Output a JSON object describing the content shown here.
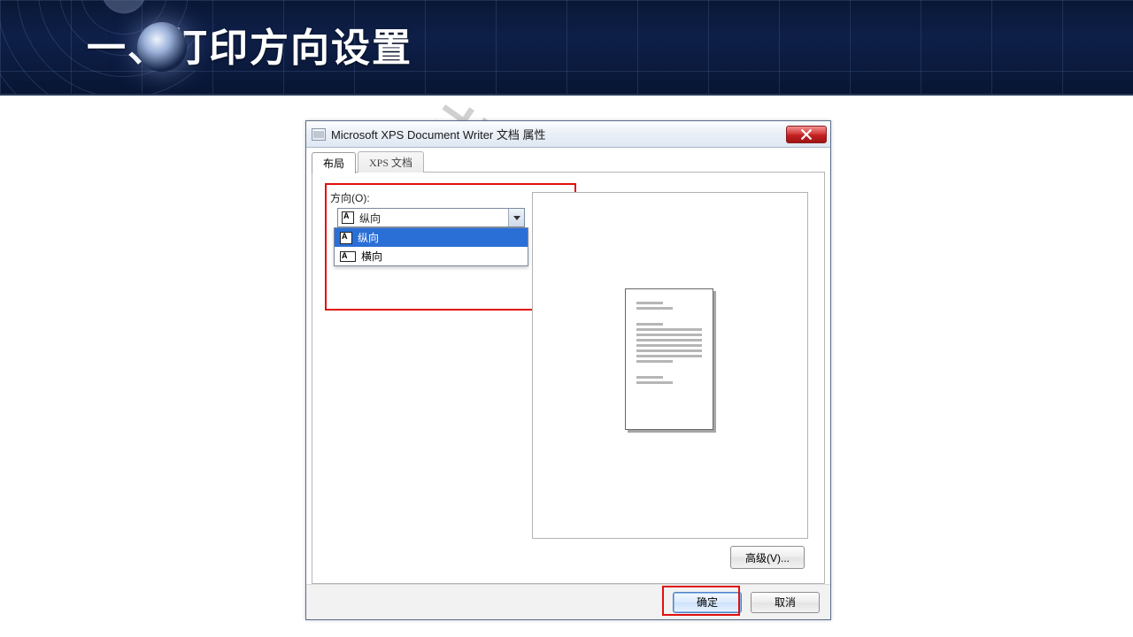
{
  "banner": {
    "title": "一、打印方向设置"
  },
  "watermark": "非会员水印",
  "dialog": {
    "title": "Microsoft XPS Document Writer 文档 属性",
    "tabs": {
      "layout": "布局",
      "xpsdoc": "XPS 文档"
    },
    "orientation": {
      "label": "方向(O):",
      "selected": "纵向",
      "options": {
        "portrait": "纵向",
        "landscape": "横向"
      }
    },
    "buttons": {
      "advanced": "高级(V)...",
      "ok": "确定",
      "cancel": "取消"
    }
  }
}
